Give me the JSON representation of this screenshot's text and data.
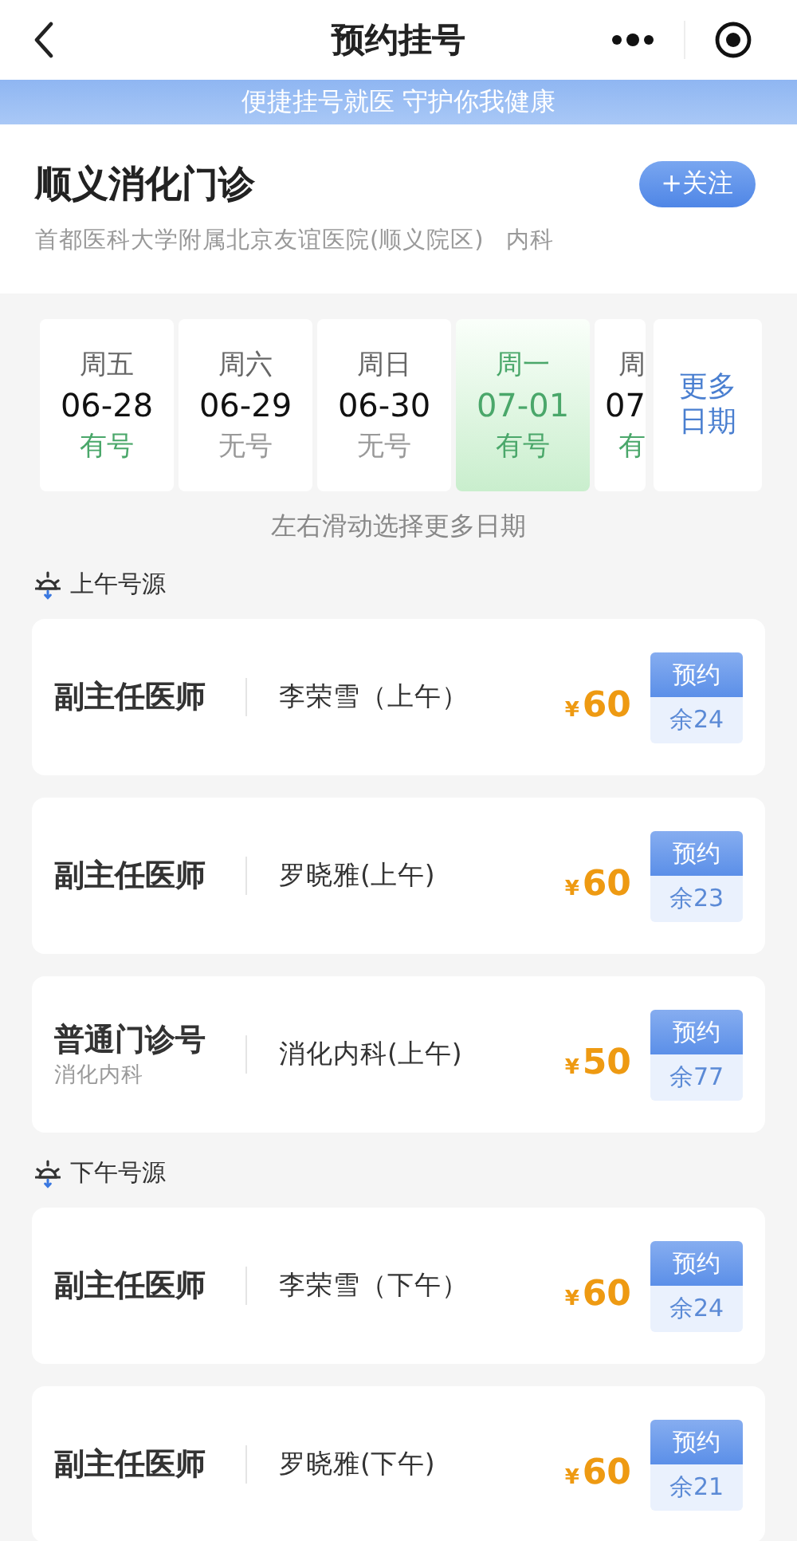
{
  "nav": {
    "title": "预约挂号"
  },
  "banner": "便捷挂号就医 守护你我健康",
  "clinic": {
    "name": "顺义消化门诊",
    "hospital": "首都医科大学附属北京友谊医院(顺义院区)",
    "department": "内科",
    "follow_button": "+关注"
  },
  "dates": [
    {
      "weekday": "周五",
      "date": "06-28",
      "status": "有号",
      "available": true,
      "selected": false,
      "partial": false
    },
    {
      "weekday": "周六",
      "date": "06-29",
      "status": "无号",
      "available": false,
      "selected": false,
      "partial": false
    },
    {
      "weekday": "周日",
      "date": "06-30",
      "status": "无号",
      "available": false,
      "selected": false,
      "partial": false
    },
    {
      "weekday": "周一",
      "date": "07-01",
      "status": "有号",
      "available": true,
      "selected": true,
      "partial": false
    },
    {
      "weekday": "周",
      "date": "07",
      "status": "有",
      "available": true,
      "selected": false,
      "partial": true
    }
  ],
  "more_dates": "更多日期",
  "hint": "左右滑动选择更多日期",
  "sections": [
    {
      "title": "上午号源",
      "slots": [
        {
          "title": "副主任医师",
          "doctor": "李荣雪（上午）",
          "currency": "¥",
          "price": "60",
          "action": "预约",
          "remaining": "余24"
        },
        {
          "title": "副主任医师",
          "doctor": "罗晓雅(上午)",
          "currency": "¥",
          "price": "60",
          "action": "预约",
          "remaining": "余23"
        },
        {
          "title": "普通门诊号",
          "subtitle": "消化内科",
          "doctor": "消化内科(上午)",
          "currency": "¥",
          "price": "50",
          "action": "预约",
          "remaining": "余77"
        }
      ]
    },
    {
      "title": "下午号源",
      "slots": [
        {
          "title": "副主任医师",
          "doctor": "李荣雪（下午）",
          "currency": "¥",
          "price": "60",
          "action": "预约",
          "remaining": "余24"
        },
        {
          "title": "副主任医师",
          "doctor": "罗晓雅(下午)",
          "currency": "¥",
          "price": "60",
          "action": "预约",
          "remaining": "余21"
        }
      ]
    }
  ]
}
